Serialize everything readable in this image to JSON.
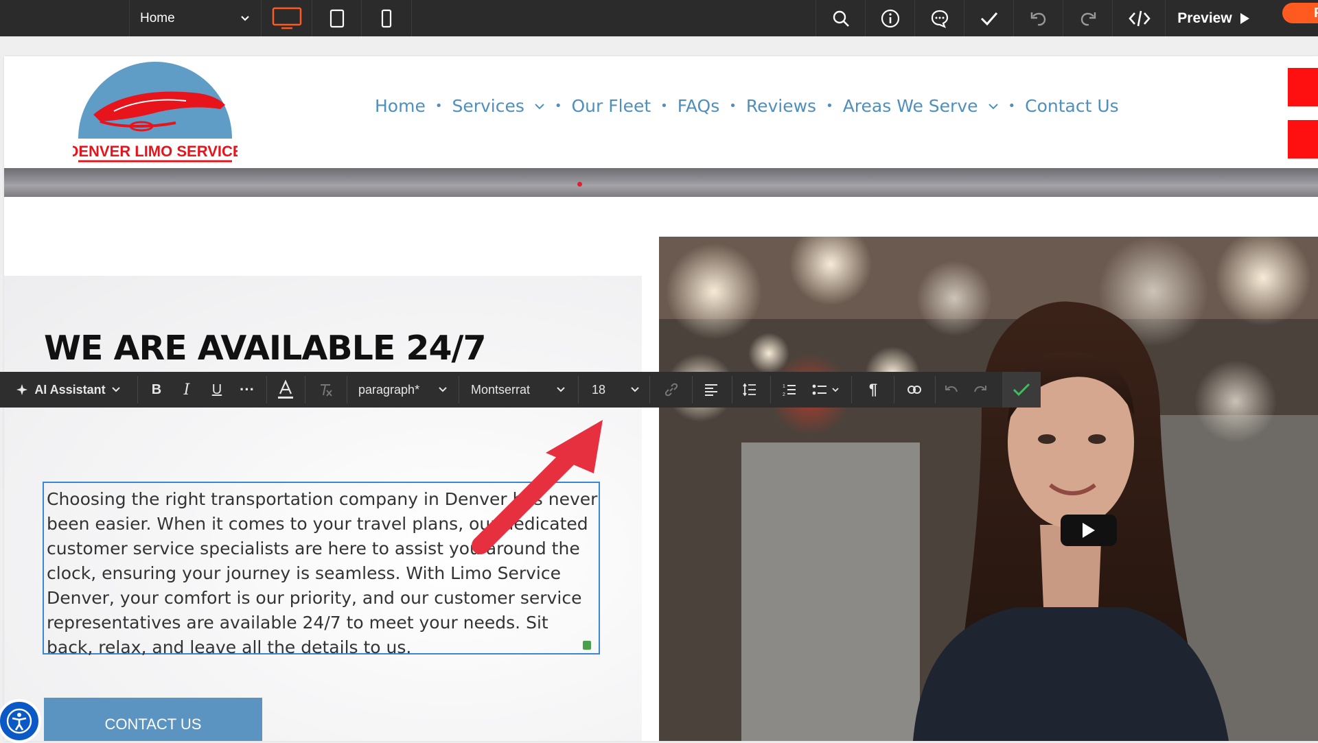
{
  "editor": {
    "page_name": "Home",
    "preview_label": "Preview",
    "publish_label": "P",
    "icons": [
      "desktop-icon",
      "tablet-icon",
      "mobile-icon",
      "search-icon",
      "info-icon",
      "comment-icon",
      "check-icon",
      "undo-icon",
      "redo-icon",
      "code-icon",
      "play-icon"
    ],
    "accent_color": "#ff5a1f"
  },
  "site": {
    "logo_text": "DENVER LIMO SERVICE",
    "nav": [
      {
        "label": "Home",
        "has_dropdown": false
      },
      {
        "label": "Services",
        "has_dropdown": true
      },
      {
        "label": "Our Fleet",
        "has_dropdown": false
      },
      {
        "label": "FAQs",
        "has_dropdown": false
      },
      {
        "label": "Reviews",
        "has_dropdown": false
      },
      {
        "label": "Areas We Serve",
        "has_dropdown": true
      },
      {
        "label": "Contact Us",
        "has_dropdown": false
      }
    ],
    "nav_color": "#4e8fbe",
    "heading": "WE ARE AVAILABLE 24/7",
    "body_text": "Choosing the right transportation company in Denver has never been easier. When it comes to your travel plans, our dedicated customer service specialists are here to assist you around the clock, ensuring your journey is seamless. With Limo Service Denver, your comfort is our priority, and our customer service representatives are available 24/7 to meet your needs. Sit back, relax, and leave all the details to us.",
    "cta_label": "CONTACT US",
    "cta_color": "#5b94c1"
  },
  "text_toolbar": {
    "ai_label": "AI Assistant",
    "block_type": "paragraph*",
    "font_family": "Montserrat",
    "font_size": "18",
    "icons": [
      "bold-icon",
      "italic-icon",
      "underline-icon",
      "more-icon",
      "text-color-icon",
      "clear-format-icon",
      "link-icon",
      "align-left-icon",
      "line-height-icon",
      "ordered-list-icon",
      "bullet-list-icon",
      "paragraph-icon",
      "unlink-icon",
      "undo-icon",
      "redo-icon",
      "confirm-icon"
    ]
  }
}
